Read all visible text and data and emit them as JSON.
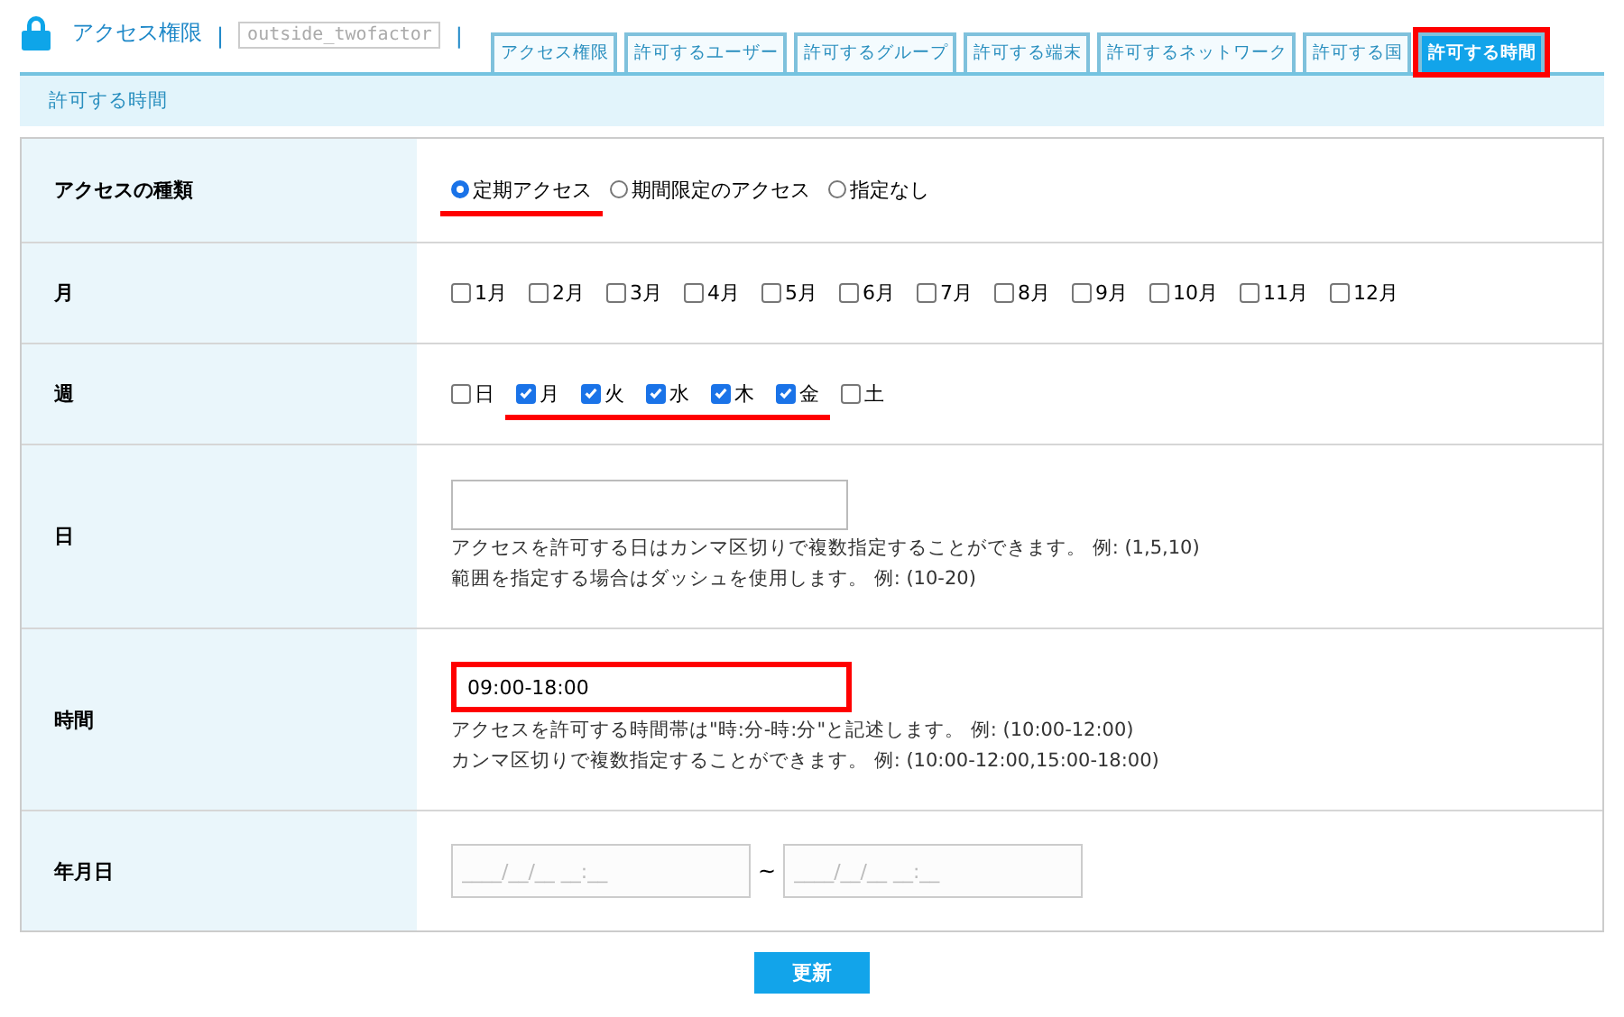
{
  "header": {
    "title": "アクセス権限",
    "separator": "|",
    "badge": "outside_twofactor",
    "separator_2": "|"
  },
  "tabs": [
    {
      "label": "アクセス権限",
      "selected": false,
      "annotated": false
    },
    {
      "label": "許可するユーザー",
      "selected": false,
      "annotated": false
    },
    {
      "label": "許可するグループ",
      "selected": false,
      "annotated": false
    },
    {
      "label": "許可する端末",
      "selected": false,
      "annotated": false
    },
    {
      "label": "許可するネットワーク",
      "selected": false,
      "annotated": false
    },
    {
      "label": "許可する国",
      "selected": false,
      "annotated": false
    },
    {
      "label": "許可する時間",
      "selected": true,
      "annotated": true
    }
  ],
  "section_title": "許可する時間",
  "rows": [
    {
      "kind": "radio",
      "label": "アクセスの種類",
      "options": [
        {
          "label": "定期アクセス",
          "selected": true,
          "annotated": true
        },
        {
          "label": "期間限定のアクセス",
          "selected": false,
          "annotated": false
        },
        {
          "label": "指定なし",
          "selected": false,
          "annotated": false
        }
      ]
    },
    {
      "kind": "checkbox",
      "label": "月",
      "options": [
        {
          "label": "1月",
          "checked": false,
          "annotated": false
        },
        {
          "label": "2月",
          "checked": false,
          "annotated": false
        },
        {
          "label": "3月",
          "checked": false,
          "annotated": false
        },
        {
          "label": "4月",
          "checked": false,
          "annotated": false
        },
        {
          "label": "5月",
          "checked": false,
          "annotated": false
        },
        {
          "label": "6月",
          "checked": false,
          "annotated": false
        },
        {
          "label": "7月",
          "checked": false,
          "annotated": false
        },
        {
          "label": "8月",
          "checked": false,
          "annotated": false
        },
        {
          "label": "9月",
          "checked": false,
          "annotated": false
        },
        {
          "label": "10月",
          "checked": false,
          "annotated": false
        },
        {
          "label": "11月",
          "checked": false,
          "annotated": false
        },
        {
          "label": "12月",
          "checked": false,
          "annotated": false
        }
      ]
    },
    {
      "kind": "checkbox",
      "label": "週",
      "options": [
        {
          "label": "日",
          "checked": false,
          "annotated": false
        },
        {
          "label": "月",
          "checked": true,
          "annotated": true
        },
        {
          "label": "火",
          "checked": true,
          "annotated": true
        },
        {
          "label": "水",
          "checked": true,
          "annotated": true
        },
        {
          "label": "木",
          "checked": true,
          "annotated": true
        },
        {
          "label": "金",
          "checked": true,
          "annotated": true
        },
        {
          "label": "土",
          "checked": false,
          "annotated": false
        }
      ]
    },
    {
      "kind": "text",
      "label": "日",
      "annotated": false,
      "help": [
        "アクセスを許可する日はカンマ区切りで複数指定することができます。 例: (1,5,10)",
        "範囲を指定する場合はダッシュを使用します。 例: (10-20)"
      ]
    },
    {
      "kind": "text",
      "label": "時間",
      "value": "09:00-18:00",
      "annotated": true,
      "help": [
        "アクセスを許可する時間帯は\"時:分-時:分\"と記述します。 例: (10:00-12:00)",
        "カンマ区切りで複数指定することができます。 例: (10:00-12:00,15:00-18:00)"
      ]
    },
    {
      "kind": "range",
      "label": "年月日",
      "from": {
        "placeholder": "____/__/__ __:__"
      },
      "separator": "~",
      "to": {
        "placeholder": "____/__/__ __:__"
      }
    }
  ],
  "submit": "更新"
}
